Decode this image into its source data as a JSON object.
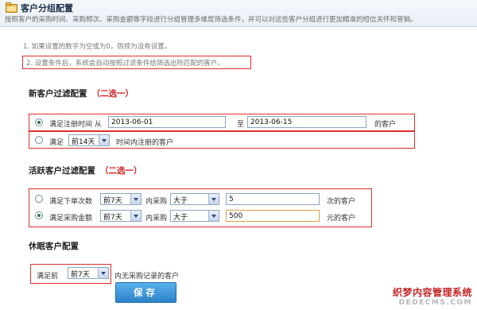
{
  "header": {
    "title": "客户分组配置",
    "description": "按照客户的采购时间、采购频次、采购金额等字段进行分组管理多维度筛选条件，并可以对这些客户分组进行更加精准的短信关怀和营销。",
    "icon": "folder-icon"
  },
  "tips": {
    "tip1": "1. 如果设置的数字为空或为0，则视为没有设置。",
    "tip2": "2. 设置条件后，系统会自动按照过滤条件给筛选出所匹配的客户。"
  },
  "new_customer": {
    "title": "新客户过滤配置",
    "choose": "（二选一）",
    "row1": {
      "label_prefix": "满足注册时间  从",
      "date_from": "2013-06-01",
      "to_label": "至",
      "date_to": "2013-06-15",
      "suffix": "的客户",
      "selected": true
    },
    "row2": {
      "label_prefix": "满足",
      "period": "前14天",
      "suffix": "时间内注册的客户",
      "selected": false
    }
  },
  "active_customer": {
    "title": "活跃客户过滤配置",
    "choose": "（二选一）",
    "row1": {
      "label": "满足下单次数",
      "period": "前7天",
      "mid": "内采购",
      "compare": "大于",
      "value": "5",
      "suffix": "次的客户",
      "selected": false
    },
    "row2": {
      "label": "满足采购金额",
      "period": "前7天",
      "mid": "内采购",
      "compare": "大于",
      "value": "500",
      "suffix": "元的客户",
      "selected": true
    }
  },
  "dormant_customer": {
    "title": "休眠客户配置",
    "label": "满足前",
    "period": "前7天",
    "suffix": "内无采购记录的客户"
  },
  "save_label": "保存",
  "watermark": {
    "line1": "织梦内容管理系统",
    "line2": "DEDECMS.COM"
  }
}
